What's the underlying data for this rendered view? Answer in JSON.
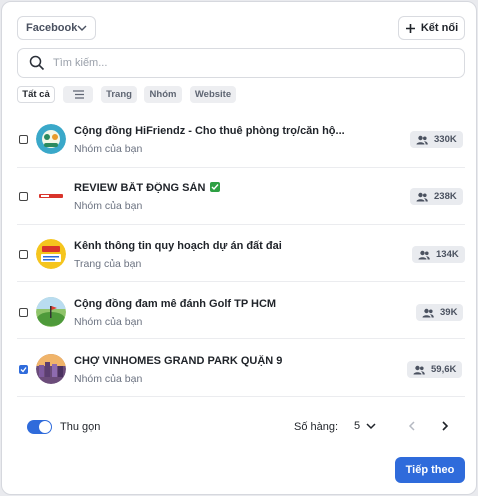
{
  "header": {
    "platform_select": "Facebook",
    "connect_label": "Kết nối"
  },
  "search": {
    "placeholder": "Tìm kiếm..."
  },
  "filters": [
    {
      "label": "Tất cả",
      "active": true
    },
    {
      "label": "",
      "icon": "list-icon"
    },
    {
      "label": "Trang"
    },
    {
      "label": "Nhóm"
    },
    {
      "label": "Website"
    }
  ],
  "items": [
    {
      "title": "Cộng đồng HiFriendz - Cho thuê phòng trọ/căn hộ...",
      "subtitle": "Nhóm của bạn",
      "count": "330K",
      "checked": false
    },
    {
      "title": "REVIEW BẤT ĐỘNG SẢN",
      "subtitle": "Nhóm của bạn",
      "count": "238K",
      "checked": false,
      "emoji": "check-mark-button"
    },
    {
      "title": "Kênh thông tin quy hoạch dự án đất đai",
      "subtitle": "Trang của bạn",
      "count": "134K",
      "checked": false
    },
    {
      "title": "Cộng đồng đam mê đánh Golf TP HCM",
      "subtitle": "Nhóm của bạn",
      "count": "39K",
      "checked": false
    },
    {
      "title": "CHỢ VINHOMES GRAND PARK QUẬN 9",
      "subtitle": "Nhóm của bạn",
      "count": "59,6K",
      "checked": true
    }
  ],
  "footer": {
    "collapse_label": "Thu gọn",
    "collapse_on": true,
    "rows_label": "Số hàng:",
    "rows_value": "5",
    "next_label": "Tiếp theo"
  },
  "colors": {
    "accent": "#2f6bdb",
    "badge_bg": "#e9ebef"
  }
}
